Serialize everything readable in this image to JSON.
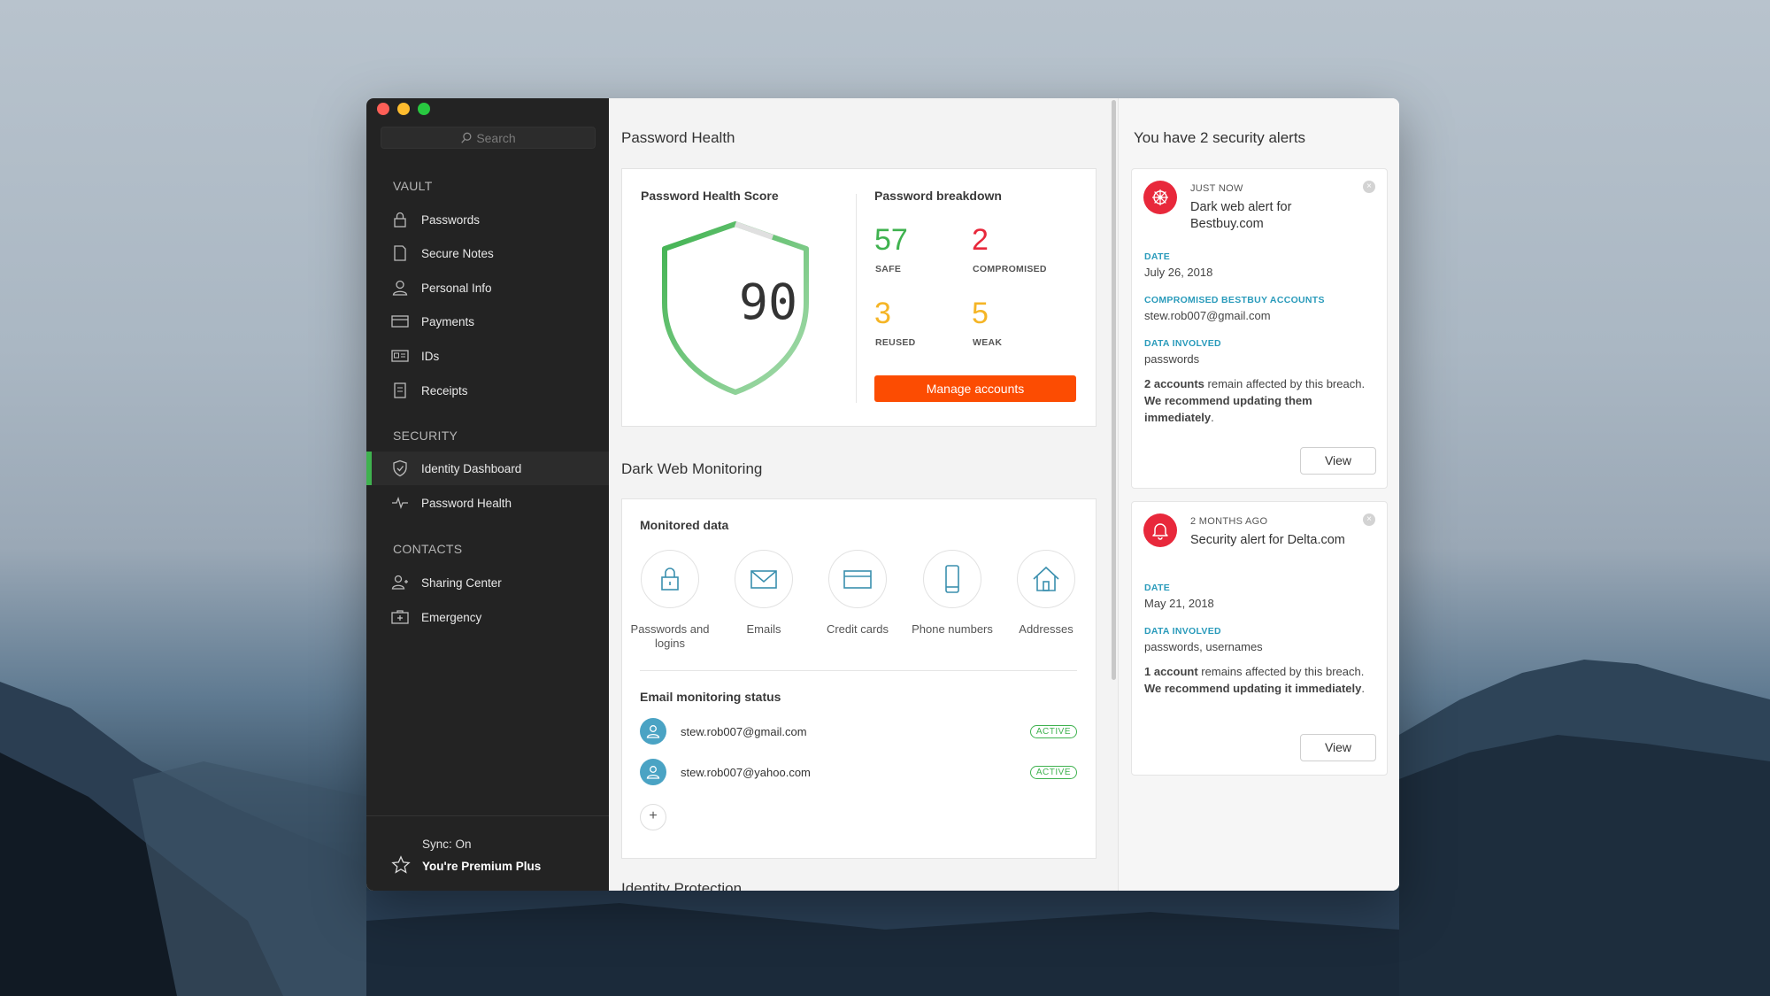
{
  "sidebar": {
    "search_placeholder": "Search",
    "vault_title": "VAULT",
    "vault_items": [
      {
        "label": "Passwords",
        "icon": "lock-icon"
      },
      {
        "label": "Secure Notes",
        "icon": "note-icon"
      },
      {
        "label": "Personal Info",
        "icon": "person-icon"
      },
      {
        "label": "Payments",
        "icon": "card-icon"
      },
      {
        "label": "IDs",
        "icon": "id-card-icon"
      },
      {
        "label": "Receipts",
        "icon": "receipt-icon"
      }
    ],
    "security_title": "SECURITY",
    "security_items": [
      {
        "label": "Identity Dashboard",
        "icon": "shield-icon",
        "active": true
      },
      {
        "label": "Password Health",
        "icon": "pulse-icon",
        "active": false
      }
    ],
    "contacts_title": "CONTACTS",
    "contacts_items": [
      {
        "label": "Sharing Center",
        "icon": "sharing-icon"
      },
      {
        "label": "Emergency",
        "icon": "emergency-icon"
      }
    ],
    "sync": "Sync: On",
    "premium": "You're Premium Plus",
    "active_color": "#3fb24f"
  },
  "password_health": {
    "section_title": "Password Health",
    "score_title": "Password Health Score",
    "score": "90",
    "breakdown_title": "Password breakdown",
    "stats": {
      "safe": {
        "value": "57",
        "label": "SAFE",
        "color": "#3fb24f"
      },
      "compromised": {
        "value": "2",
        "label": "COMPROMISED",
        "color": "#e8283b"
      },
      "reused": {
        "value": "3",
        "label": "REUSED",
        "color": "#f5b526"
      },
      "weak": {
        "value": "5",
        "label": "WEAK",
        "color": "#f5b526"
      }
    },
    "manage_button": "Manage accounts"
  },
  "dark_web": {
    "section_title": "Dark Web Monitoring",
    "monitored_title": "Monitored data",
    "monitored_items": [
      {
        "label": "Passwords and logins",
        "icon": "lock-icon"
      },
      {
        "label": "Emails",
        "icon": "envelope-icon"
      },
      {
        "label": "Credit cards",
        "icon": "credit-card-icon"
      },
      {
        "label": "Phone numbers",
        "icon": "phone-icon"
      },
      {
        "label": "Addresses",
        "icon": "house-icon"
      }
    ],
    "email_status_title": "Email monitoring status",
    "emails": [
      {
        "address": "stew.rob007@gmail.com",
        "status": "ACTIVE"
      },
      {
        "address": "stew.rob007@yahoo.com",
        "status": "ACTIVE"
      }
    ],
    "add_label": "+"
  },
  "next_section_title": "Identity Protection",
  "alerts": {
    "title": "You have 2 security alerts",
    "items": [
      {
        "time": "JUST NOW",
        "title": "Dark web alert for Bestbuy.com",
        "icon": "dark-web-icon",
        "date_label": "DATE",
        "date": "July 26, 2018",
        "accounts_label": "COMPROMISED BESTBUY ACCOUNTS",
        "accounts": "stew.rob007@gmail.com",
        "data_label": "DATA INVOLVED",
        "data": "passwords",
        "body_bold1": "2 accounts",
        "body_text": " remain affected by this breach. ",
        "body_bold2": "We recommend updating them immediately",
        "body_end": ".",
        "view": "View"
      },
      {
        "time": "2 MONTHS AGO",
        "title": "Security alert for Delta.com",
        "icon": "bell-icon",
        "date_label": "DATE",
        "date": "May 21, 2018",
        "data_label": "DATA INVOLVED",
        "data": "passwords, usernames",
        "body_bold1": "1 account",
        "body_text": " remains affected by this breach. ",
        "body_bold2": "We recommend updating it immediately",
        "body_end": ".",
        "view": "View"
      }
    ]
  }
}
